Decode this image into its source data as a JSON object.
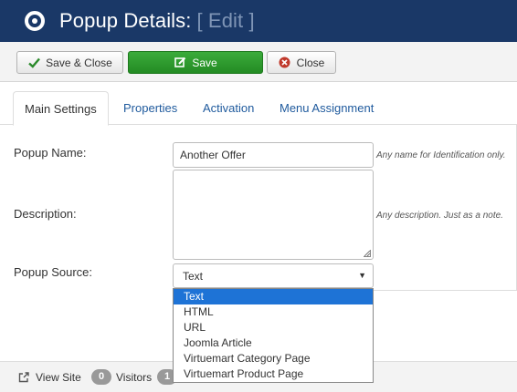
{
  "header": {
    "title": "Popup Details:",
    "subtitle": "[ Edit ]",
    "icon": "circle-dot-icon"
  },
  "toolbar": {
    "save_close_label": "Save & Close",
    "save_label": "Save",
    "close_label": "Close"
  },
  "tabs": [
    {
      "label": "Main Settings",
      "active": true
    },
    {
      "label": "Properties",
      "active": false
    },
    {
      "label": "Activation",
      "active": false
    },
    {
      "label": "Menu Assignment",
      "active": false
    }
  ],
  "form": {
    "popup_name": {
      "label": "Popup Name:",
      "value": "Another Offer",
      "hint": "Any name for Identification only."
    },
    "description": {
      "label": "Description:",
      "value": "",
      "hint": "Any description. Just as a note."
    },
    "popup_source": {
      "label": "Popup Source:",
      "selected": "Text",
      "options": [
        "Text",
        "HTML",
        "URL",
        "Joomla Article",
        "Virtuemart Category Page",
        "Virtuemart Product Page"
      ]
    }
  },
  "footer": {
    "view_site": "View Site",
    "visitors_count": "0",
    "visitors_label": "Visitors",
    "admin_count": "1"
  },
  "colors": {
    "header_bg": "#1a3867",
    "save_green": "#2fa32f",
    "selected_blue": "#1e73d6",
    "link_blue": "#1f5a9d"
  }
}
